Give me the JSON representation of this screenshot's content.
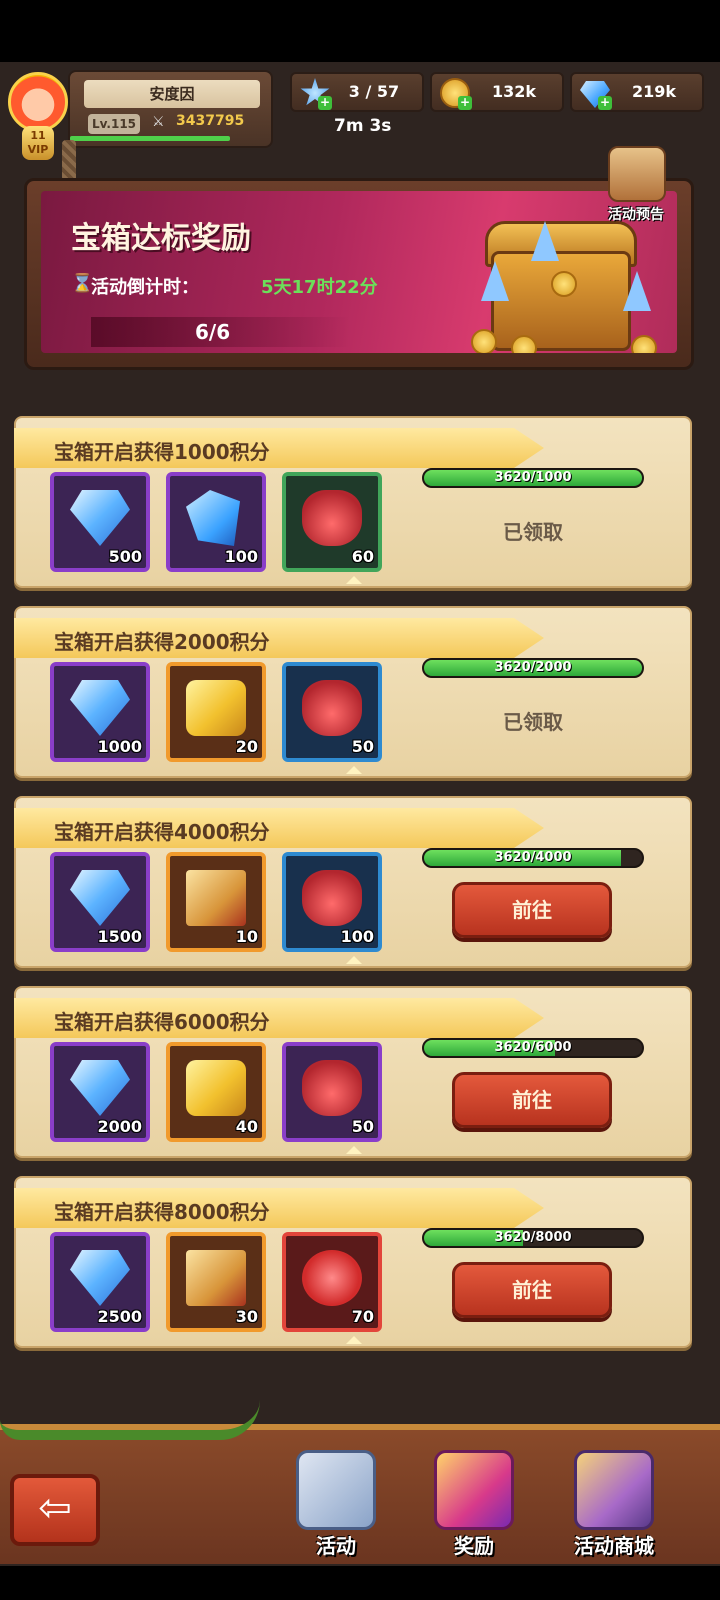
{
  "player": {
    "name": "安度因",
    "level": "Lv.115",
    "power": "3437795",
    "vip": "11",
    "vip_label": "VIP"
  },
  "resources": {
    "stamina": "3 / 57",
    "stamina_timer": "7m 3s",
    "gold": "132k",
    "gems": "219k"
  },
  "banner": {
    "title": "宝箱达标奖励",
    "countdown_label": "活动倒计时：",
    "countdown_value": "5天17时22分",
    "progress": "6/6",
    "preview_label": "活动预告"
  },
  "tasks": [
    {
      "title": "宝箱开启获得1000积分",
      "progress_text": "3620/1000",
      "progress_fraction": 1,
      "status": "已领取",
      "items": [
        {
          "icon": "gem-icon",
          "count": "500",
          "rarity": "purple"
        },
        {
          "icon": "crystal-shard-icon",
          "count": "100",
          "rarity": "purple"
        },
        {
          "icon": "lucky-bag-icon",
          "count": "60",
          "rarity": "green"
        }
      ]
    },
    {
      "title": "宝箱开启获得2000积分",
      "progress_text": "3620/2000",
      "progress_fraction": 1,
      "status": "已领取",
      "items": [
        {
          "icon": "gem-icon",
          "count": "1000",
          "rarity": "purple"
        },
        {
          "icon": "gold-ore-icon",
          "count": "20",
          "rarity": "orange"
        },
        {
          "icon": "lucky-bag-icon",
          "count": "50",
          "rarity": "blue"
        }
      ]
    },
    {
      "title": "宝箱开启获得4000积分",
      "progress_text": "3620/4000",
      "progress_fraction": 0.905,
      "button": "前往",
      "items": [
        {
          "icon": "gem-icon",
          "count": "1500",
          "rarity": "purple"
        },
        {
          "icon": "spell-book-icon",
          "count": "10",
          "rarity": "orange"
        },
        {
          "icon": "lucky-bag-icon",
          "count": "100",
          "rarity": "blue"
        }
      ]
    },
    {
      "title": "宝箱开启获得6000积分",
      "progress_text": "3620/6000",
      "progress_fraction": 0.603,
      "button": "前往",
      "items": [
        {
          "icon": "gem-icon",
          "count": "2000",
          "rarity": "purple"
        },
        {
          "icon": "gold-ore-icon",
          "count": "40",
          "rarity": "orange"
        },
        {
          "icon": "lucky-bag-icon",
          "count": "50",
          "rarity": "purple"
        }
      ]
    },
    {
      "title": "宝箱开启获得8000积分",
      "progress_text": "3620/8000",
      "progress_fraction": 0.4525,
      "button": "前往",
      "items": [
        {
          "icon": "gem-icon",
          "count": "2500",
          "rarity": "purple"
        },
        {
          "icon": "spell-book-icon",
          "count": "30",
          "rarity": "orange"
        },
        {
          "icon": "paw-token-icon",
          "count": "70",
          "rarity": "red"
        }
      ]
    }
  ],
  "bottom_nav": {
    "back_icon": "arrow-left-icon",
    "tabs": [
      {
        "label": "活动",
        "icon": "gift-box-icon"
      },
      {
        "label": "奖励",
        "icon": "reward-gift-icon"
      },
      {
        "label": "活动商城",
        "icon": "treasure-shop-icon"
      }
    ]
  },
  "colors": {
    "banner": "#b0285c",
    "progress_fill": "#2ea83a",
    "go_button": "#d1442c",
    "card_bg": "#f0ddb4"
  }
}
